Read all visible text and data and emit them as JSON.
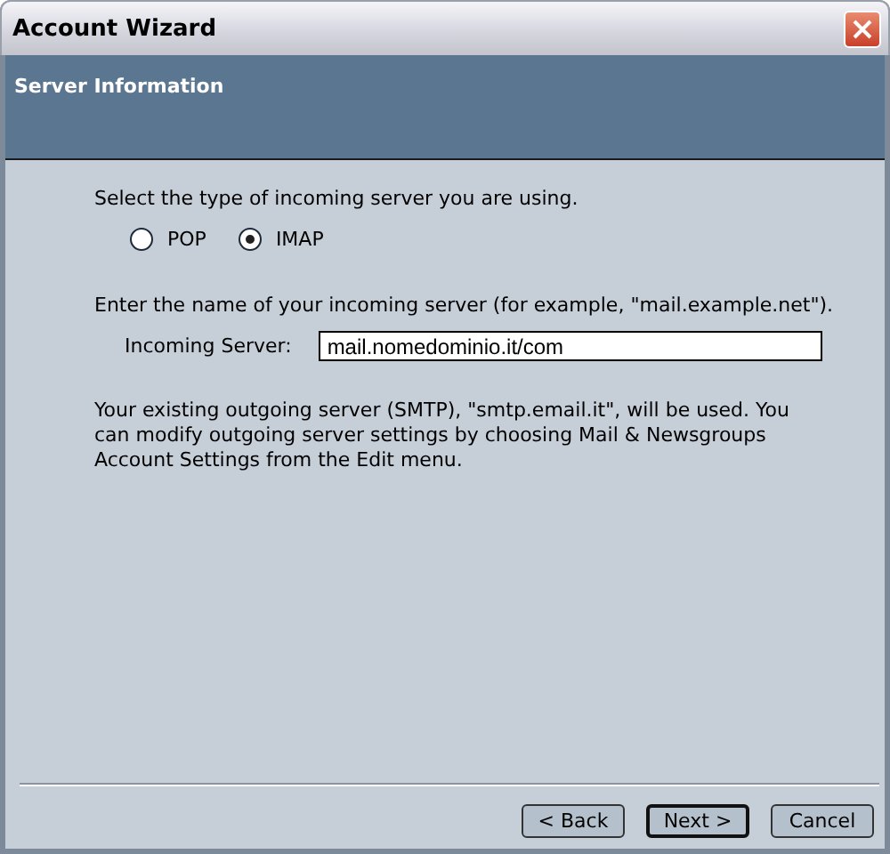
{
  "window": {
    "title": "Account Wizard"
  },
  "header": {
    "title": "Server Information"
  },
  "server_type": {
    "prompt": "Select the type of incoming server you are using.",
    "options": [
      {
        "label": "POP",
        "selected": false
      },
      {
        "label": "IMAP",
        "selected": true
      }
    ]
  },
  "incoming": {
    "prompt": "Enter the name of your incoming server (for example, \"mail.example.net\").",
    "label": "Incoming Server:",
    "value": "mail.nomedominio.it/com"
  },
  "note": "Your existing outgoing server (SMTP), \"smtp.email.it\", will be used. You can modify outgoing server settings by choosing Mail & Newsgroups Account Settings from the Edit menu.",
  "buttons": [
    {
      "label": "< Back",
      "default": false
    },
    {
      "label": "Next >",
      "default": true
    },
    {
      "label": "Cancel",
      "default": false
    }
  ]
}
